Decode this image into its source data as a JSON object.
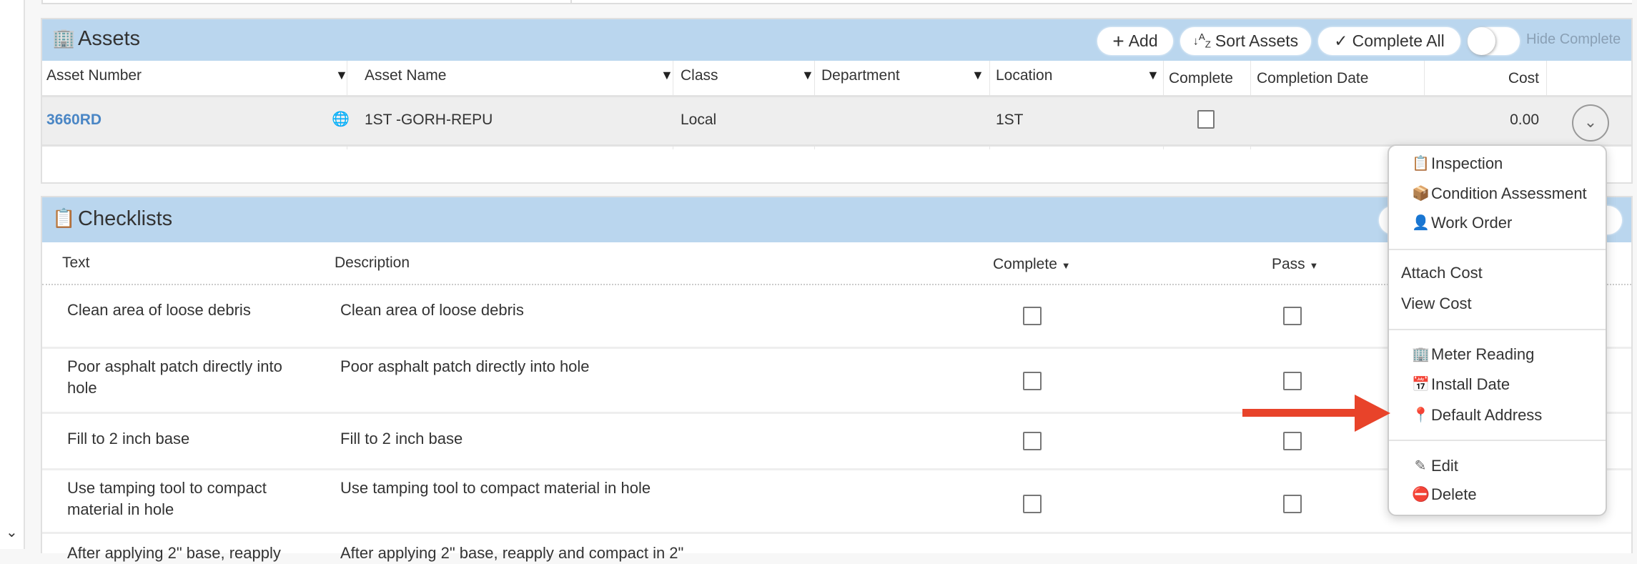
{
  "assets": {
    "title": "Assets",
    "icon": "building-icon",
    "buttons": {
      "add": "Add",
      "sort": "Sort Assets",
      "complete_all": "Complete All",
      "hide_complete": "Hide Complete"
    },
    "hide_complete_on": false,
    "columns": [
      "Asset Number",
      "Asset Name",
      "Class",
      "Department",
      "Location",
      "Complete",
      "Completion Date",
      "Cost"
    ],
    "rows": [
      {
        "asset_number": "3660RD",
        "asset_name": "1ST -GORH-REPU",
        "class": "Local",
        "department": "",
        "location": "1ST",
        "complete": false,
        "completion_date": "",
        "cost": "0.00"
      }
    ],
    "link_color": "#4a86c5",
    "header_color": "#bad6ee"
  },
  "checklists": {
    "title": "Checklists",
    "icon": "clipboard-check-icon",
    "columns": {
      "text": "Text",
      "description": "Description",
      "complete": "Complete",
      "pass": "Pass"
    },
    "rows": [
      {
        "text": "Clean area of loose debris",
        "description": "Clean area of loose debris",
        "complete": false,
        "pass": false
      },
      {
        "text": "Poor asphalt patch directly into hole",
        "description": "Poor asphalt patch directly into hole",
        "complete": false,
        "pass": false
      },
      {
        "text": "Fill to 2 inch base",
        "description": "Fill to 2 inch base",
        "complete": false,
        "pass": false
      },
      {
        "text": "Use tamping tool to compact material in hole",
        "description": "Use tamping tool to compact material in hole",
        "complete": false,
        "pass": false
      },
      {
        "text": "After applying 2\" base, reapply",
        "description": "After applying 2\" base, reapply and compact in 2\""
      }
    ]
  },
  "menu": {
    "items": [
      {
        "label": "Inspection",
        "icon": "clipboard-list-icon"
      },
      {
        "label": "Condition Assessment",
        "icon": "hands-box-icon"
      },
      {
        "label": "Work Order",
        "icon": "worker-icon"
      },
      {
        "label": "Attach Cost"
      },
      {
        "label": "View Cost"
      },
      {
        "label": "Meter Reading",
        "icon": "building-icon"
      },
      {
        "label": "Install Date",
        "icon": "calendar-icon"
      },
      {
        "label": "Default Address",
        "icon": "map-pin-icon"
      },
      {
        "label": "Edit",
        "icon": "pencil-icon"
      },
      {
        "label": "Delete",
        "icon": "minus-circle-icon"
      }
    ]
  },
  "annotation": {
    "arrow_color": "#e8432a",
    "points_to": "Default Address"
  }
}
